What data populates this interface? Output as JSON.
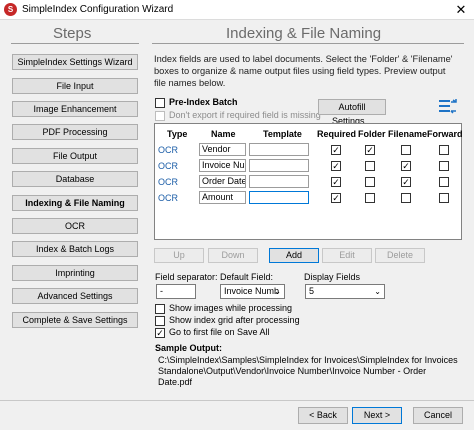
{
  "window": {
    "title": "SimpleIndex Configuration Wizard",
    "app_icon_glyph": "S",
    "close_glyph": "✕"
  },
  "steps": {
    "heading": "Steps",
    "items": [
      {
        "label": "SimpleIndex Settings Wizard"
      },
      {
        "label": "File Input"
      },
      {
        "label": "Image Enhancement"
      },
      {
        "label": "PDF Processing"
      },
      {
        "label": "File Output"
      },
      {
        "label": "Database"
      },
      {
        "label": "Indexing & File Naming",
        "active": true
      },
      {
        "label": "OCR"
      },
      {
        "label": "Index & Batch Logs"
      },
      {
        "label": "Imprinting"
      },
      {
        "label": "Advanced Settings"
      },
      {
        "label": "Complete & Save Settings"
      }
    ]
  },
  "main": {
    "heading": "Indexing & File Naming",
    "description": "Index fields are used to label documents. Select the 'Folder' & 'Filename' boxes to organize & name output files using field types. Preview output file names below.",
    "pre_index_batch": {
      "label": "Pre-Index Batch",
      "checked": false
    },
    "dont_export": {
      "label": "Don't export if required field is missing",
      "checked": false,
      "disabled": true
    },
    "autofill_label": "Autofill Settings...",
    "fields_icon": "fields-settings-icon",
    "check_glyph": "✓"
  },
  "grid": {
    "columns": [
      "Type",
      "Name",
      "Template",
      "Required",
      "Folder",
      "Filename",
      "Forward"
    ],
    "rows": [
      {
        "type": "OCR",
        "name": "Vendor",
        "template": "",
        "required": true,
        "folder": true,
        "filename": false,
        "forward": false
      },
      {
        "type": "OCR",
        "name": "Invoice Num",
        "template": "",
        "required": true,
        "folder": false,
        "filename": true,
        "forward": false
      },
      {
        "type": "OCR",
        "name": "Order Date",
        "template": "",
        "required": true,
        "folder": false,
        "filename": true,
        "forward": false
      },
      {
        "type": "OCR",
        "name": "Amount",
        "template": "",
        "required": true,
        "folder": false,
        "filename": false,
        "forward": false
      }
    ]
  },
  "row_buttons": {
    "up": "Up",
    "down": "Down",
    "add": "Add",
    "edit": "Edit",
    "delete": "Delete"
  },
  "options": {
    "field_separator_label": "Field separator:",
    "field_separator_value": "-",
    "default_field_label": "Default Field:",
    "default_field_value": "Invoice Numb",
    "display_fields_label": "Display Fields",
    "display_fields_value": "5",
    "dropdown_glyph": "⌄",
    "show_images": {
      "label": "Show images while processing",
      "checked": false
    },
    "show_index_grid": {
      "label": "Show index grid after processing",
      "checked": false
    },
    "go_first_file": {
      "label": "Go to first file on Save All",
      "checked": true
    }
  },
  "sample": {
    "title": "Sample Output:",
    "path": "C:\\SimpleIndex\\Samples\\SimpleIndex for Invoices\\SimpleIndex for Invoices Standalone\\Output\\Vendor\\Invoice Number\\Invoice Number - Order Date.pdf"
  },
  "nav": {
    "back": "< Back",
    "next": "Next >",
    "cancel": "Cancel"
  }
}
